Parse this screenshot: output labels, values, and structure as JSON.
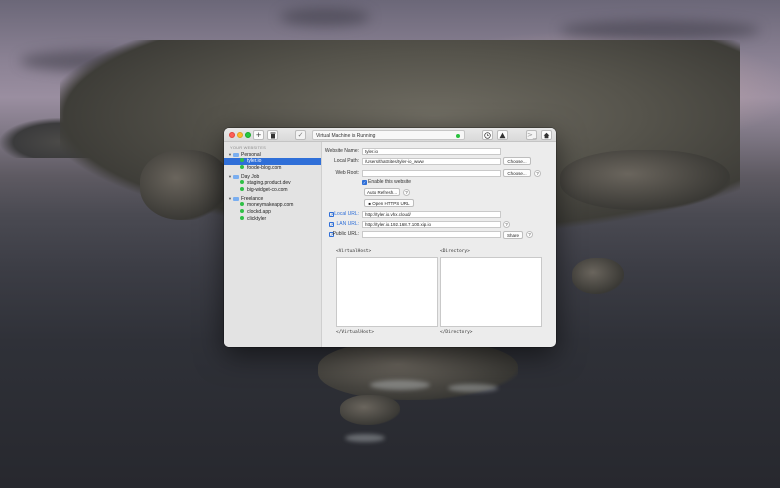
{
  "toolbar": {
    "add_icon": "plus-icon",
    "delete_icon": "trash-icon",
    "check_icon": "checkmark-icon",
    "status_text": "Virtual Machine is Running",
    "status_color": "#29c23f",
    "clock_icon": "clock-icon",
    "warning_icon": "warning-icon",
    "terminal_icon": "terminal-icon",
    "home_icon": "home-icon"
  },
  "sidebar": {
    "header": "YOUR WEBSITES",
    "groups": [
      {
        "label": "Personal",
        "sites": [
          "tyler.io",
          "foode-blog.com"
        ]
      },
      {
        "label": "Day Job",
        "sites": [
          "staging.product.dev",
          "big-widget-co.com"
        ]
      },
      {
        "label": "Freelance",
        "sites": [
          "moneymakeapp.com",
          "clockd.app",
          "clicktyler"
        ]
      }
    ],
    "selected_site": "tyler.io"
  },
  "form": {
    "website_name_label": "Website Name:",
    "website_name_value": "tyler.io",
    "local_path_label": "Local Path:",
    "local_path_value": "/Users/thatSites/tyler-io_www",
    "choose_button": "Choose...",
    "web_root_label": "Web Root:",
    "web_root_value": "",
    "choose_button_2": "Choose...",
    "help_glyph": "?",
    "enable_label": "Enable this website",
    "enable_checked": true,
    "auto_refresh_button": "Auto Refresh...",
    "open_https_button": "Open HTTPS URL",
    "local_url_label": "Local URL:",
    "local_url_value": "http://tyler.io.vhx.cloud/",
    "lan_url_label": "LAN URL:",
    "lan_url_value": "http://tyler.io.192.168.7.100.xip.io",
    "public_url_label": "Public URL:",
    "public_url_value": "",
    "share_button": "Share",
    "vhost_open": "<VirtualHost>",
    "vhost_close": "</VirtualHost>",
    "dir_open": "<Directory>",
    "dir_close": "</Directory>",
    "accent_color": "#2f6fd8"
  }
}
